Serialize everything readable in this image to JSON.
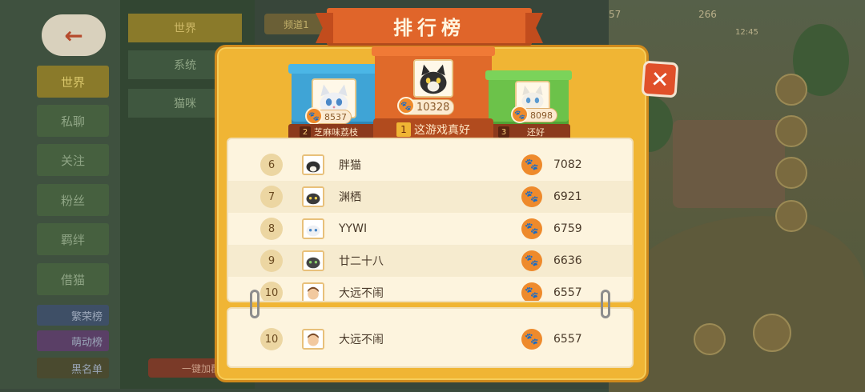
{
  "background": {
    "back_icon": "arrow-left-icon",
    "left_tabs": [
      "世界",
      "私聊",
      "关注",
      "粉丝",
      "羁绊",
      "借猫"
    ],
    "rank_tabs": [
      "繁荣榜",
      "萌动榜",
      "黑名单"
    ],
    "mid_tabs": [
      "世界",
      "系统",
      "猫咪"
    ],
    "channel_label": "频道1",
    "one_key_label": "一键加群",
    "coin_left": "57",
    "coin_right": "266",
    "time_label": "12:45"
  },
  "modal": {
    "title": "排行榜",
    "close_icon": "close-icon",
    "podium": [
      {
        "rank": "2",
        "name": "芝麻味荔枝",
        "score": "8537",
        "color": "#3fa4d6"
      },
      {
        "rank": "1",
        "name": "这游戏真好",
        "score": "10328",
        "color": "#e06a2a"
      },
      {
        "rank": "3",
        "name": "还好",
        "score": "8098",
        "color": "#6cc24a"
      }
    ],
    "list": [
      {
        "rank": "6",
        "name": "胖猫",
        "score": "7082"
      },
      {
        "rank": "7",
        "name": "渊栖",
        "score": "6921"
      },
      {
        "rank": "8",
        "name": "YYWI",
        "score": "6759"
      },
      {
        "rank": "9",
        "name": "廿二十八",
        "score": "6636"
      },
      {
        "rank": "10",
        "name": "大远不闹",
        "score": "6557"
      }
    ],
    "mine": {
      "rank": "10",
      "name": "大远不闹",
      "score": "6557"
    },
    "paw_icon": "paw-icon",
    "accent": "#f0b534"
  }
}
